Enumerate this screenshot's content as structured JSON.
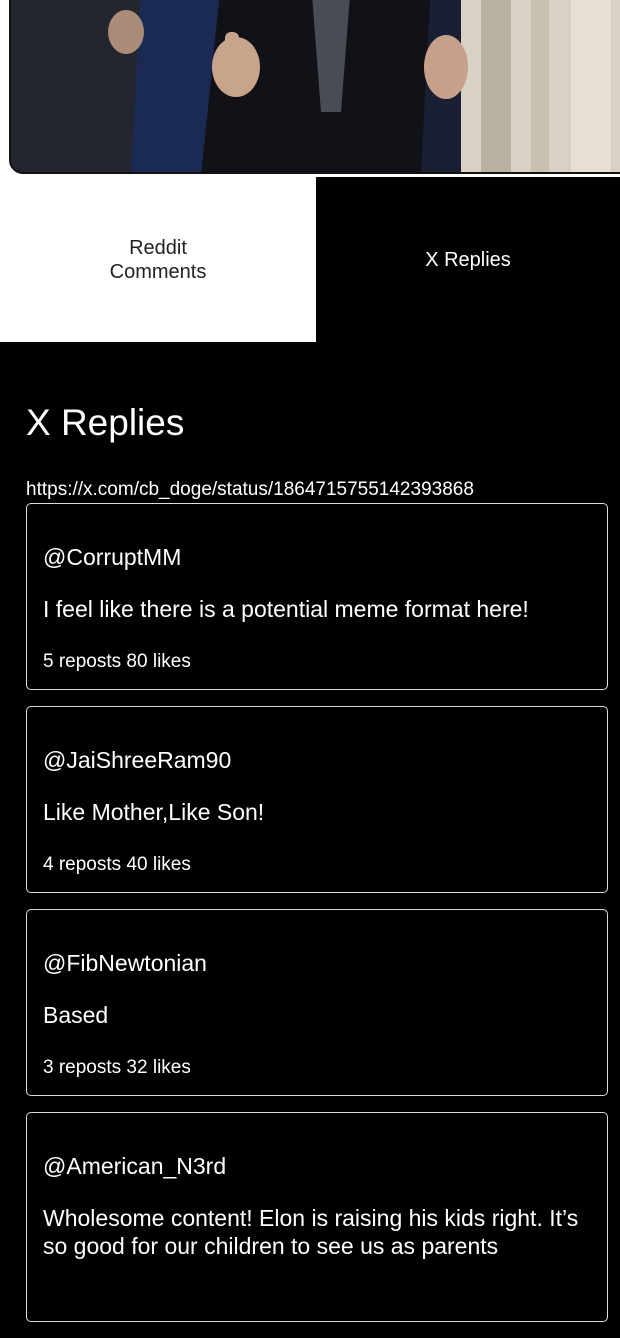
{
  "tabs": {
    "reddit_label": "Reddit Comments",
    "x_label": "X Replies"
  },
  "section": {
    "title": "X Replies",
    "link": "https://x.com/cb_doge/status/1864715755142393868"
  },
  "replies": [
    {
      "handle": "@CorruptMM",
      "text": "I feel like there is a potential meme format here!",
      "stats": "5 reposts 80 likes"
    },
    {
      "handle": "@JaiShreeRam90",
      "text": "Like Mother,Like Son!",
      "stats": "4 reposts 40 likes"
    },
    {
      "handle": "@FibNewtonian",
      "text": "Based",
      "stats": "3 reposts 32 likes"
    },
    {
      "handle": "@American_N3rd",
      "text": "Wholesome content! Elon is raising his kids right. It’s so good for our children to see us as parents",
      "stats": ""
    }
  ],
  "colors": {
    "background": "#000000",
    "card_border": "#dddddd",
    "inactive_tab": "#ffffff"
  }
}
